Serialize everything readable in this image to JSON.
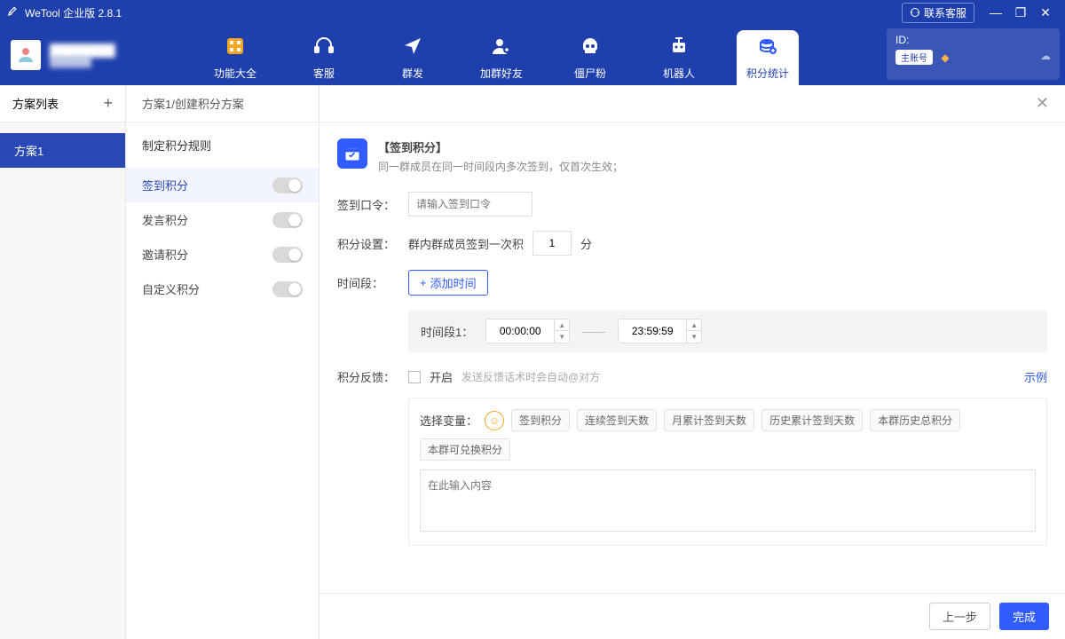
{
  "titlebar": {
    "app_name": "WeTool 企业版 2.8.1",
    "contact_support": "联系客服"
  },
  "user": {
    "name_masked": "████████",
    "sub_masked": "██████"
  },
  "id_card": {
    "id_label": "ID:",
    "badge": "主账号"
  },
  "nav": [
    {
      "label": "功能大全",
      "icon": "grid"
    },
    {
      "label": "客服",
      "icon": "headset"
    },
    {
      "label": "群发",
      "icon": "send"
    },
    {
      "label": "加群好友",
      "icon": "add-user"
    },
    {
      "label": "僵尸粉",
      "icon": "skull"
    },
    {
      "label": "机器人",
      "icon": "robot"
    },
    {
      "label": "积分统计",
      "icon": "stats"
    }
  ],
  "sidebar": {
    "title": "方案列表",
    "items": [
      "方案1"
    ]
  },
  "crumb": "方案1/创建积分方案",
  "section_title": "制定积分规则",
  "rules": [
    {
      "label": "签到积分",
      "on": false,
      "active": true
    },
    {
      "label": "发言积分",
      "on": false,
      "active": false
    },
    {
      "label": "邀请积分",
      "on": false,
      "active": false
    },
    {
      "label": "自定义积分",
      "on": false,
      "active": false
    }
  ],
  "detail": {
    "info_title": "【签到积分】",
    "info_desc": "同一群成员在同一时间段内多次签到，仅首次生效；",
    "command_label": "签到口令：",
    "command_placeholder": "请输入签到口令",
    "score_label": "积分设置：",
    "score_text_before": "群内群成员签到一次积",
    "score_value": "1",
    "score_text_after": "分",
    "period_label": "时间段：",
    "add_time": "添加时间",
    "slot_label": "时间段1：",
    "time_start": "00:00:00",
    "time_end": "23:59:59",
    "feedback_label": "积分反馈：",
    "feedback_enable": "开启",
    "feedback_hint": "发送反馈话术时会自动@对方",
    "example": "示例",
    "var_label": "选择变量：",
    "vars": [
      "签到积分",
      "连续签到天数",
      "月累计签到天数",
      "历史累计签到天数",
      "本群历史总积分",
      "本群可兑换积分"
    ],
    "var_textarea_placeholder": "在此输入内容"
  },
  "footer": {
    "prev": "上一步",
    "done": "完成"
  }
}
